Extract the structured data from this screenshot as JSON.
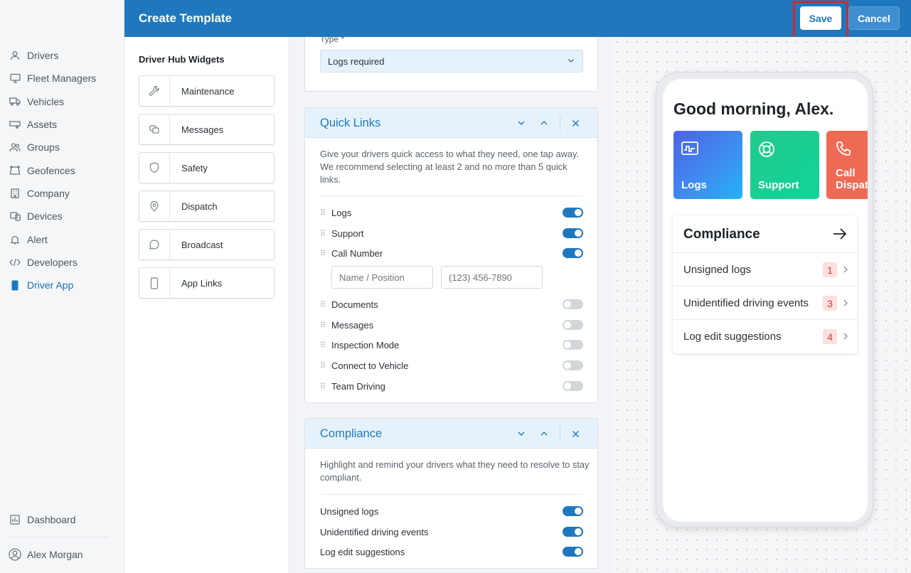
{
  "sidebar": {
    "items": [
      {
        "label": "Drivers",
        "icon": "user-icon"
      },
      {
        "label": "Fleet Managers",
        "icon": "monitor-icon"
      },
      {
        "label": "Vehicles",
        "icon": "truck-icon"
      },
      {
        "label": "Assets",
        "icon": "trailer-icon"
      },
      {
        "label": "Groups",
        "icon": "users-icon"
      },
      {
        "label": "Geofences",
        "icon": "geofence-icon"
      },
      {
        "label": "Company",
        "icon": "building-icon"
      },
      {
        "label": "Devices",
        "icon": "devices-icon"
      },
      {
        "label": "Alert",
        "icon": "bell-icon"
      },
      {
        "label": "Developers",
        "icon": "code-icon"
      },
      {
        "label": "Driver App",
        "icon": "phone-icon"
      }
    ],
    "dashboard_label": "Dashboard",
    "user_name": "Alex Morgan"
  },
  "header": {
    "title": "Create Template",
    "save_label": "Save",
    "cancel_label": "Cancel"
  },
  "widgets": {
    "heading": "Driver Hub Widgets",
    "items": [
      {
        "label": "Maintenance",
        "icon": "wrench-icon"
      },
      {
        "label": "Messages",
        "icon": "messages-icon"
      },
      {
        "label": "Safety",
        "icon": "shield-icon"
      },
      {
        "label": "Dispatch",
        "icon": "map-pin-icon"
      },
      {
        "label": "Broadcast",
        "icon": "chat-bubble-icon"
      },
      {
        "label": "App Links",
        "icon": "phone-icon"
      }
    ]
  },
  "type_card": {
    "label": "Type *",
    "value": "Logs required"
  },
  "quick_links": {
    "title": "Quick Links",
    "description": "Give your drivers quick access to what they need, one tap away. We recommend selecting at least 2 and no more than 5 quick links.",
    "items": [
      {
        "label": "Logs",
        "enabled": true
      },
      {
        "label": "Support",
        "enabled": true
      },
      {
        "label": "Call Number",
        "enabled": true
      },
      {
        "label": "Documents",
        "enabled": false
      },
      {
        "label": "Messages",
        "enabled": false
      },
      {
        "label": "Inspection Mode",
        "enabled": false
      },
      {
        "label": "Connect to Vehicle",
        "enabled": false
      },
      {
        "label": "Team Driving",
        "enabled": false
      }
    ],
    "name_placeholder": "Name / Position",
    "phone_placeholder": "(123) 456-7890"
  },
  "compliance": {
    "title": "Compliance",
    "description": "Highlight and remind your drivers what they need to resolve to stay compliant.",
    "items": [
      {
        "label": "Unsigned logs",
        "enabled": true
      },
      {
        "label": "Unidentified driving events",
        "enabled": true
      },
      {
        "label": "Log edit suggestions",
        "enabled": true
      }
    ]
  },
  "preview": {
    "greeting": "Good morning, Alex.",
    "tiles": [
      {
        "label": "Logs",
        "icon": "logs-icon",
        "color": "#4d6fe6"
      },
      {
        "label": "Support",
        "icon": "lifebuoy-icon",
        "color": "#1fc58e"
      },
      {
        "label": "Call Dispat",
        "label_line1": "Call",
        "label_line2": "Dispat",
        "icon": "phone-call-icon",
        "color": "#ef6a55"
      }
    ],
    "compliance_title": "Compliance",
    "compliance_rows": [
      {
        "label": "Unsigned logs",
        "count": "1"
      },
      {
        "label": "Unidentified driving events",
        "count": "3"
      },
      {
        "label": "Log edit suggestions",
        "count": "4"
      }
    ]
  },
  "colors": {
    "header": "#1f78bd",
    "accent": "#1f78bd",
    "highlight": "#d22b2b"
  }
}
